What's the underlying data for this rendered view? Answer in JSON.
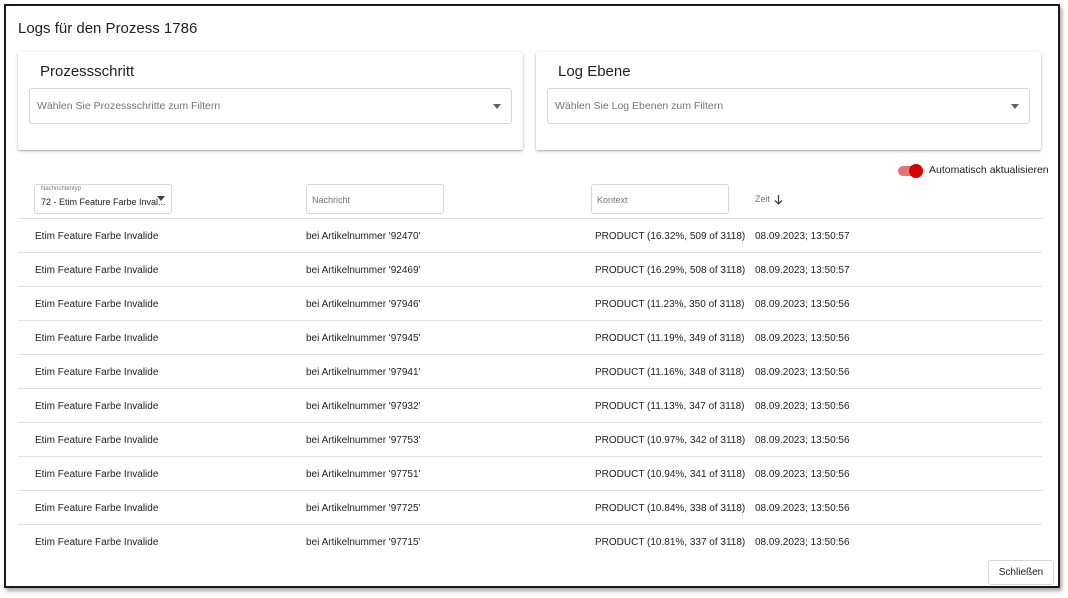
{
  "dialog": {
    "title": "Logs für den Prozess 1786"
  },
  "filters": {
    "prozessschritt": {
      "title": "Prozessschritt",
      "placeholder": "Wählen Sie Prozessschritte zum Filtern"
    },
    "log_ebene": {
      "title": "Log Ebene",
      "placeholder": "Wählen Sie Log Ebenen zum Filtern"
    }
  },
  "auto_refresh": {
    "label": "Automatisch aktualisieren",
    "enabled": true,
    "color": "#d50000"
  },
  "columns": {
    "type": {
      "label": "Nachrichtentyp",
      "value": "72 - Etim Feature Farbe Inval..."
    },
    "message": {
      "placeholder": "Nachricht"
    },
    "context": {
      "placeholder": "Kontext"
    },
    "time": {
      "label": "Zeit",
      "sort": "descending",
      "icon": "arrow-down-icon"
    }
  },
  "rows": [
    {
      "type": "Etim Feature Farbe Invalide",
      "message": "bei Artikelnummer '92470'",
      "context": "PRODUCT (16.32%, 509 of 3118)",
      "time": "08.09.2023; 13:50:57"
    },
    {
      "type": "Etim Feature Farbe Invalide",
      "message": "bei Artikelnummer '92469'",
      "context": "PRODUCT (16.29%, 508 of 3118)",
      "time": "08.09.2023; 13:50:57"
    },
    {
      "type": "Etim Feature Farbe Invalide",
      "message": "bei Artikelnummer '97946'",
      "context": "PRODUCT (11.23%, 350 of 3118)",
      "time": "08.09.2023; 13:50:56"
    },
    {
      "type": "Etim Feature Farbe Invalide",
      "message": "bei Artikelnummer '97945'",
      "context": "PRODUCT (11.19%, 349 of 3118)",
      "time": "08.09.2023; 13:50:56"
    },
    {
      "type": "Etim Feature Farbe Invalide",
      "message": "bei Artikelnummer '97941'",
      "context": "PRODUCT (11.16%, 348 of 3118)",
      "time": "08.09.2023; 13:50:56"
    },
    {
      "type": "Etim Feature Farbe Invalide",
      "message": "bei Artikelnummer '97932'",
      "context": "PRODUCT (11.13%, 347 of 3118)",
      "time": "08.09.2023; 13:50:56"
    },
    {
      "type": "Etim Feature Farbe Invalide",
      "message": "bei Artikelnummer '97753'",
      "context": "PRODUCT (10.97%, 342 of 3118)",
      "time": "08.09.2023; 13:50:56"
    },
    {
      "type": "Etim Feature Farbe Invalide",
      "message": "bei Artikelnummer '97751'",
      "context": "PRODUCT (10.94%, 341 of 3118)",
      "time": "08.09.2023; 13:50:56"
    },
    {
      "type": "Etim Feature Farbe Invalide",
      "message": "bei Artikelnummer '97725'",
      "context": "PRODUCT (10.84%, 338 of 3118)",
      "time": "08.09.2023; 13:50:56"
    },
    {
      "type": "Etim Feature Farbe Invalide",
      "message": "bei Artikelnummer '97715'",
      "context": "PRODUCT (10.81%, 337 of 3118)",
      "time": "08.09.2023; 13:50:56"
    }
  ],
  "actions": {
    "close_label": "Schließen"
  }
}
